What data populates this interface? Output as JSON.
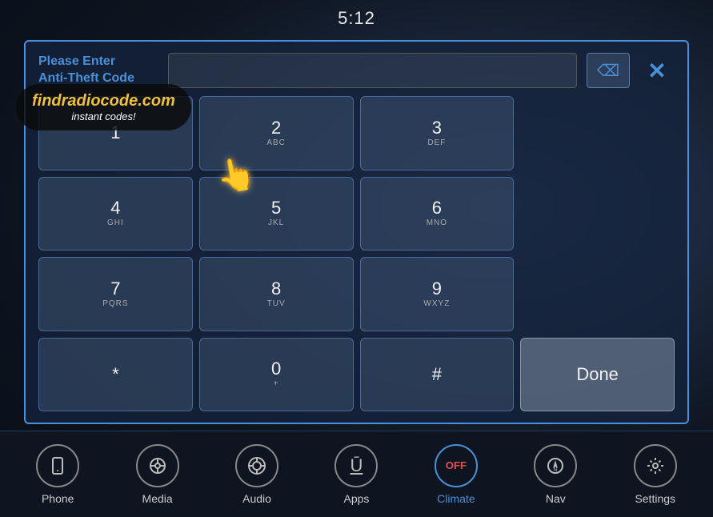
{
  "time": "5:12",
  "header": {
    "prompt_line1": "Please Enter",
    "prompt_line2": "Anti-Theft Code",
    "input_placeholder": "",
    "backspace_symbol": "⌫",
    "close_symbol": "✕"
  },
  "keypad": {
    "rows": [
      [
        {
          "main": "1",
          "sub": ""
        },
        {
          "main": "2",
          "sub": "ABC"
        },
        {
          "main": "3",
          "sub": "DEF"
        },
        {
          "main": "",
          "sub": "",
          "empty": true
        }
      ],
      [
        {
          "main": "4",
          "sub": "GHI"
        },
        {
          "main": "5",
          "sub": "JKL"
        },
        {
          "main": "6",
          "sub": "MNO"
        },
        {
          "main": "",
          "sub": "",
          "empty": true
        }
      ],
      [
        {
          "main": "7",
          "sub": "PQRS"
        },
        {
          "main": "8",
          "sub": "TUV"
        },
        {
          "main": "9",
          "sub": "WXYZ"
        },
        {
          "main": "",
          "sub": "",
          "empty": true
        }
      ],
      [
        {
          "main": "*",
          "sub": ""
        },
        {
          "main": "0",
          "sub": "+"
        },
        {
          "main": "#",
          "sub": ""
        },
        {
          "main": "Done",
          "sub": "",
          "done": true
        }
      ]
    ]
  },
  "watermark": {
    "url": "findradiocode.com",
    "tagline": "instant codes!"
  },
  "nav": {
    "items": [
      {
        "label": "Phone",
        "icon": "📱",
        "active": false
      },
      {
        "label": "Media",
        "icon": "♪",
        "active": false
      },
      {
        "label": "Audio",
        "icon": "🎚",
        "active": false
      },
      {
        "label": "Apps",
        "icon": "Ū",
        "active": false
      },
      {
        "label": "Climate",
        "icon": "OFF",
        "active": true,
        "special": true
      },
      {
        "label": "Nav",
        "icon": "N",
        "active": false
      },
      {
        "label": "Settings",
        "icon": "⚙",
        "active": false
      }
    ]
  },
  "colors": {
    "accent": "#4a90d9",
    "active": "#4a90d9",
    "inactive": "#888888",
    "off_red": "#e05050"
  }
}
